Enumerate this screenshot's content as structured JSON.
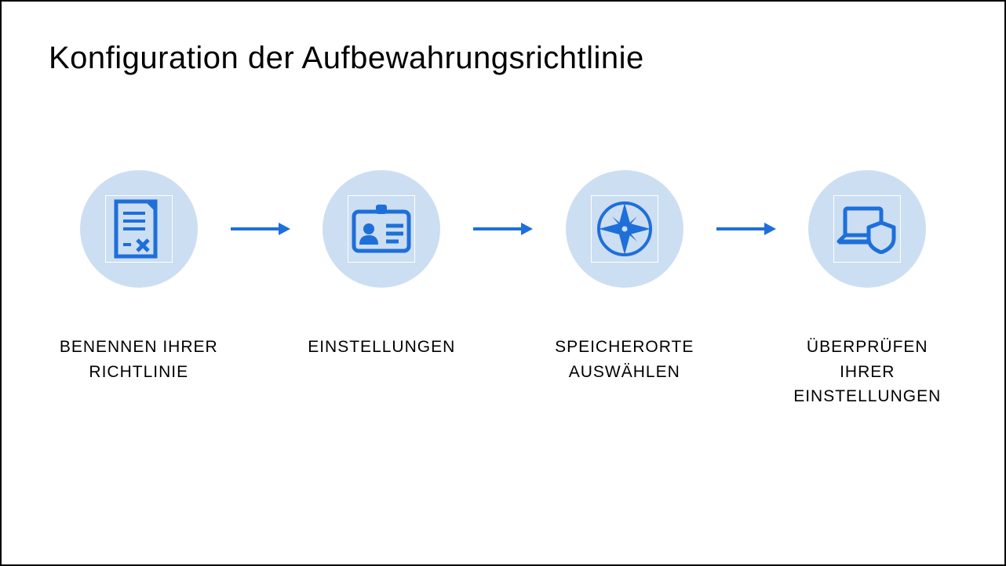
{
  "title": "Konfiguration der Aufbewahrungsrichtlinie",
  "steps": [
    {
      "label": "BENENNEN IHRER RICHTLINIE",
      "icon": "document-x-icon"
    },
    {
      "label": "EINSTELLUNGEN",
      "icon": "badge-icon"
    },
    {
      "label": "SPEICHERORTE AUSWÄHLEN",
      "icon": "compass-icon"
    },
    {
      "label": "ÜBERPRÜFEN IHRER EINSTELLUNGEN",
      "icon": "laptop-shield-icon"
    }
  ],
  "colors": {
    "accent": "#1e6fd9",
    "circle": "#ccdef2"
  }
}
